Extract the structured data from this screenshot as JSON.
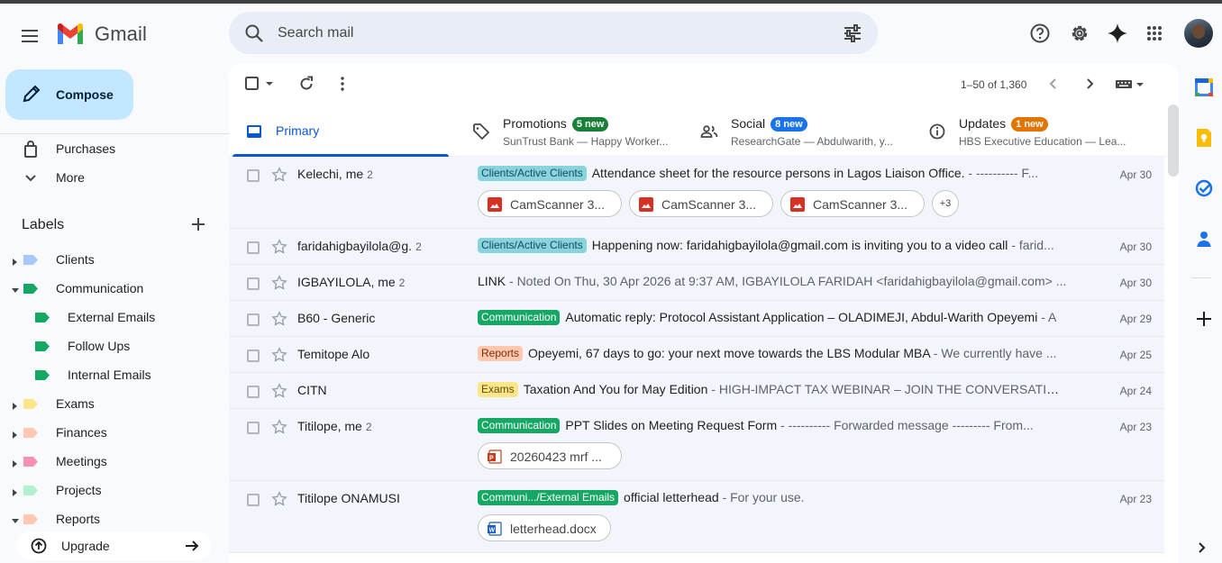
{
  "app": {
    "brand": "Gmail"
  },
  "colors": {
    "accent": "#0b57d0",
    "compose_bg": "#c2e7ff",
    "search_bg": "#e9eef6",
    "row_bg": "#f2f6fc"
  },
  "search": {
    "placeholder": "Search mail"
  },
  "compose": {
    "label": "Compose"
  },
  "nav": {
    "items": [
      {
        "label": "Purchases",
        "icon": "shopping-bag-icon"
      },
      {
        "label": "More",
        "icon": "chevron-down-icon"
      }
    ],
    "labels_header": "Labels",
    "labels": [
      {
        "label": "Clients",
        "color": "#a8c7fa",
        "expand": "collapsed"
      },
      {
        "label": "Communication",
        "color": "#16a765",
        "expand": "expanded"
      },
      {
        "label": "External Emails",
        "color": "#16a765",
        "sub": true
      },
      {
        "label": "Follow Ups",
        "color": "#16a765",
        "sub": true
      },
      {
        "label": "Internal Emails",
        "color": "#16a765",
        "sub": true
      },
      {
        "label": "Exams",
        "color": "#fde68a",
        "expand": "collapsed"
      },
      {
        "label": "Finances",
        "color": "#ffc8af",
        "expand": "collapsed"
      },
      {
        "label": "Meetings",
        "color": "#f691b2",
        "expand": "collapsed"
      },
      {
        "label": "Projects",
        "color": "#b3efd3",
        "expand": "collapsed"
      },
      {
        "label": "Reports",
        "color": "#ffc8af",
        "expand": "expanded"
      }
    ],
    "upgrade": "Upgrade"
  },
  "toolbar": {
    "pager": "1–50 of 1,360"
  },
  "tabs": [
    {
      "label": "Primary",
      "icon": "inbox-icon"
    },
    {
      "label": "Promotions",
      "badge": "5 new",
      "badge_color": "#188038",
      "sub": "SunTrust Bank — Happy Worker...",
      "icon": "tag-icon"
    },
    {
      "label": "Social",
      "badge": "8 new",
      "badge_color": "#1a73e8",
      "sub": "ResearchGate — Abdulwarith, y...",
      "icon": "people-icon"
    },
    {
      "label": "Updates",
      "badge": "1 new",
      "badge_color": "#e37400",
      "sub": "HBS Executive Education — Lea...",
      "icon": "info-icon"
    }
  ],
  "emails": [
    {
      "sender": "Kelechi, me",
      "count": "2",
      "label": "Clients/Active Clients",
      "label_bg": "#89d3dd",
      "label_fg": "#0b4f5c",
      "subject": "Attendance sheet for the resource persons in Lagos Liaison Office.",
      "snippet": " - ---------- F...",
      "date": "Apr 30",
      "attachments": [
        {
          "name": "CamScanner 3...",
          "type": "pdf"
        },
        {
          "name": "CamScanner 3...",
          "type": "pdf"
        },
        {
          "name": "CamScanner 3...",
          "type": "pdf"
        }
      ],
      "more": "+3"
    },
    {
      "sender": "faridahigbayilola@g.",
      "count": "2",
      "label": "Clients/Active Clients",
      "label_bg": "#89d3dd",
      "label_fg": "#0b4f5c",
      "subject": "Happening now: faridahigbayilola@gmail.com is inviting you to a video call",
      "snippet": " - farid...",
      "date": "Apr 30"
    },
    {
      "sender": "IGBAYILOLA, me",
      "count": "2",
      "label": "",
      "subject": "LINK",
      "snippet": " - Noted On Thu, 30 Apr 2026 at 9:37 AM, IGBAYILOLA FARIDAH <faridahigbayilola@gmail.com> ...",
      "date": "Apr 30"
    },
    {
      "sender": "B60 - Generic",
      "count": "",
      "label": "Communication",
      "label_bg": "#16a765",
      "label_fg": "#ffffff",
      "subject": "Automatic reply: Protocol Assistant Application – OLADIMEJI, Abdul-Warith Opeyemi",
      "snippet": " - A",
      "date": "Apr 29"
    },
    {
      "sender": "Temitope Alo",
      "count": "",
      "label": "Reports",
      "label_bg": "#ffc8af",
      "label_fg": "#7a2e0e",
      "subject": "Opeyemi, 67 days to go: your next move towards the LBS Modular MBA",
      "snippet": " - We currently have ...",
      "date": "Apr 25"
    },
    {
      "sender": "CITN",
      "count": "",
      "label": "Exams",
      "label_bg": "#fde68a",
      "label_fg": "#594c05",
      "subject": "Taxation And You for May Edition",
      "snippet": " - HIGH-IMPACT TAX WEBINAR – JOIN THE CONVERSATION ...",
      "date": "Apr 24"
    },
    {
      "sender": "Titilope, me",
      "count": "2",
      "label": "Communication",
      "label_bg": "#16a765",
      "label_fg": "#ffffff",
      "subject": "PPT Slides on Meeting Request Form",
      "snippet": " - ---------- Forwarded message --------- From...",
      "date": "Apr 23",
      "attachments": [
        {
          "name": "20260423 mrf ...",
          "type": "ppt"
        }
      ]
    },
    {
      "sender": "Titilope ONAMUSI",
      "count": "",
      "label": "Communi.../External Emails",
      "label_bg": "#16a765",
      "label_fg": "#ffffff",
      "subject": "official letterhead",
      "snippet": " - For your use.",
      "date": "Apr 23",
      "attachments": [
        {
          "name": "letterhead.docx",
          "type": "doc"
        }
      ]
    }
  ]
}
